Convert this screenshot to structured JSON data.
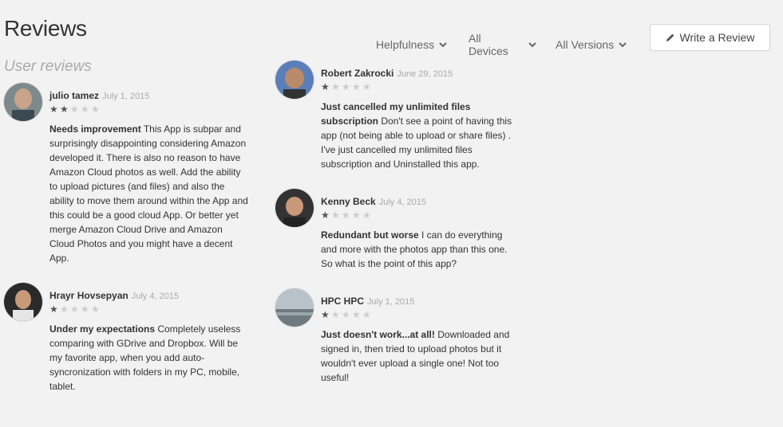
{
  "header": {
    "title": "Reviews",
    "subtitle": "User reviews",
    "filters": [
      {
        "label": "Helpfulness"
      },
      {
        "label": "All Devices"
      },
      {
        "label": "All Versions"
      }
    ],
    "write_review_label": "Write a Review"
  },
  "reviews": [
    {
      "name": "julio tamez",
      "date": "July 1, 2015",
      "rating": 2,
      "headline": "Needs improvement",
      "text": "This App is subpar and surprisingly disappointing considering Amazon developed it. There is also no reason to have Amazon Cloud photos as well. Add the ability to upload pictures (and files) and also the ability to move them around within the App and this could be a good cloud App. Or better yet merge Amazon Cloud Drive and Amazon Cloud Photos and you might have a decent App."
    },
    {
      "name": "Hrayr Hovsepyan",
      "date": "July 4, 2015",
      "rating": 1,
      "headline": "Under my expectations",
      "text": "Completely useless comparing with GDrive and Dropbox. Will be my favorite app, when you add auto-syncronization with folders in my PC, mobile, tablet."
    },
    {
      "name": "Robert Zakrocki",
      "date": "June 29, 2015",
      "rating": 1,
      "headline": "Just cancelled my unlimited files subscription",
      "text": "Don't see a point of having this app (not being able to upload or share files) . I've just cancelled my unlimited files subscription and Uninstalled this app."
    },
    {
      "name": "Kenny Beck",
      "date": "July 4, 2015",
      "rating": 1,
      "headline": "Redundant but worse",
      "text": "I can do everything and more with the photos app than this one. So what is the point of this app?"
    },
    {
      "name": "HPC HPC",
      "date": "July 1, 2015",
      "rating": 1,
      "headline": "Just doesn't work...at all!",
      "text": "Downloaded and signed in, then tried to upload photos but it wouldn't ever upload a single one! Not too useful!"
    }
  ],
  "colors": {
    "background": "#f2f2f2",
    "star_on": "#555555",
    "star_off": "#cccccc",
    "muted_text": "#aaaaaa"
  }
}
